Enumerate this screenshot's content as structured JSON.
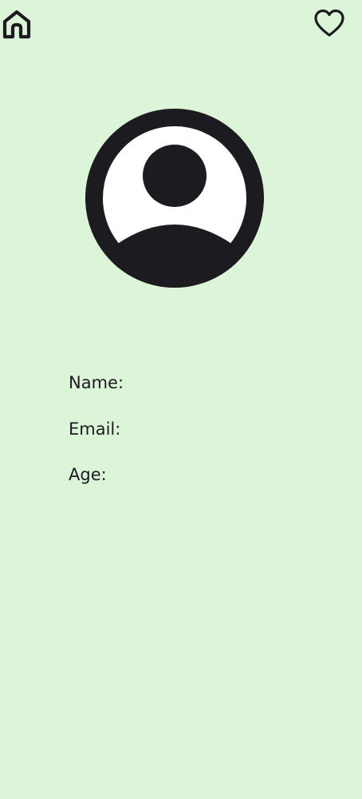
{
  "app": {
    "background_color": "#dcf5d9",
    "icon_color": "#1c1b1f"
  },
  "top_bar": {
    "left_icon": "home-icon",
    "right_icon": "heart-outline-icon"
  },
  "avatar": {
    "icon": "account-circle-icon"
  },
  "profile": {
    "fields": [
      {
        "label": "Name:",
        "value": ""
      },
      {
        "label": "Email:",
        "value": ""
      },
      {
        "label": "Age:",
        "value": ""
      }
    ]
  }
}
